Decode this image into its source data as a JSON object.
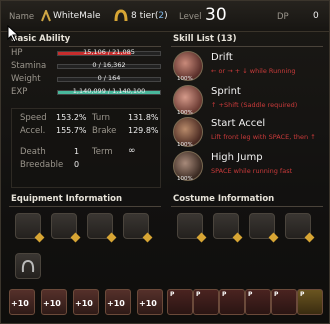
{
  "header": {
    "name_label": "Name",
    "name_value": "WhiteMale",
    "tier": "8 tier(",
    "tier_num": "2",
    "tier_close": ")",
    "level_label": "Level",
    "level_value": "30",
    "dp_label": "DP",
    "dp_value": "0"
  },
  "basic": {
    "title": "Basic Ability",
    "hp": {
      "label": "HP",
      "text": "15,106 / 21,085",
      "fraction": 0.716,
      "color": "#c62d2d"
    },
    "stamina": {
      "label": "Stamina",
      "text": "0 / 16,362",
      "fraction": 0
    },
    "weight": {
      "label": "Weight",
      "text": "0 / 164",
      "fraction": 0
    },
    "exp": {
      "label": "EXP",
      "text": "1,140,099 / 1,140,100",
      "fraction": 1.0,
      "color": "#49b89c"
    },
    "speed_label": "Speed",
    "speed": "153.2%",
    "turn_label": "Turn",
    "turn": "131.8%",
    "accel_label": "Accel.",
    "accel": "155.7%",
    "brake_label": "Brake",
    "brake": "129.8%",
    "death_label": "Death",
    "death": "1",
    "term_label": "Term",
    "term": "∞",
    "breed_label": "Breedable",
    "breed": "0"
  },
  "skills": {
    "title": "Skill List (13)",
    "items": [
      {
        "name": "Drift",
        "desc": "← or → + ↓ while Running",
        "pct": "100%"
      },
      {
        "name": "Sprint",
        "desc": "↑ +Shift (Saddle required)",
        "pct": "100%"
      },
      {
        "name": "Start Accel",
        "desc": "Lift front leg with SPACE, then ↑",
        "pct": "100%"
      },
      {
        "name": "High Jump",
        "desc": "SPACE while running fast",
        "pct": "100%"
      }
    ]
  },
  "equipment": {
    "title": "Equipment Information"
  },
  "costume": {
    "title": "Costume Information"
  },
  "inventory": {
    "plus": "+10",
    "p": "P"
  }
}
